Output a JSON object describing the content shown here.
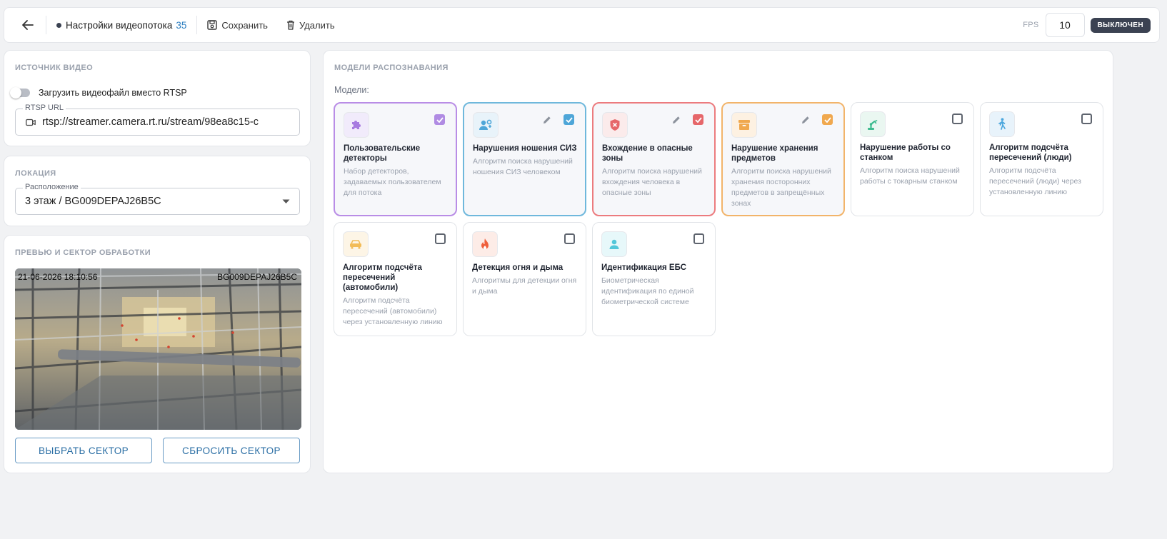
{
  "header": {
    "title": "Настройки видеопотока",
    "stream_id": "35",
    "save_label": "Сохранить",
    "delete_label": "Удалить",
    "fps_label": "FPS",
    "fps_value": "10",
    "status_label": "ВЫКЛЮЧЕН"
  },
  "source": {
    "title": "ИСТОЧНИК ВИДЕО",
    "upload_toggle_label": "Загрузить видеофайл вместо RTSP",
    "upload_toggle_on": false,
    "rtsp_label": "RTSP URL",
    "rtsp_value": "rtsp://streamer.camera.rt.ru/stream/98ea8c15-c"
  },
  "location": {
    "title": "ЛОКАЦИЯ",
    "field_label": "Расположение",
    "value": "3 этаж / BG009DEPAJ26B5C"
  },
  "preview": {
    "title": "ПРЕВЬЮ И СЕКТОР ОБРАБОТКИ",
    "timestamp": "21-06-2026 18:10:56",
    "camera_label": "BG009DEPAJ26B5C",
    "select_sector_label": "ВЫБРАТЬ СЕКТОР",
    "reset_sector_label": "СБРОСИТЬ СЕКТОР"
  },
  "models": {
    "title": "МОДЕЛИ РАСПОЗНАВАНИЯ",
    "subtitle": "Модели:",
    "cards": [
      {
        "title": "Пользовательские детекторы",
        "desc": "Набор детекторов, задаваемых пользователем для потока",
        "checked": true,
        "editable": false,
        "color": "#a77be0",
        "icon": "puzzle-icon"
      },
      {
        "title": "Нарушения ношения СИЗ",
        "desc": "Алгоритм поиска нарушений ношения СИЗ человеком",
        "checked": true,
        "editable": true,
        "color": "#5aafd9",
        "icon": "worker-gear-icon"
      },
      {
        "title": "Вхождение в опасные зоны",
        "desc": "Алгоритм поиска нарушений вхождения человека в опасные зоны",
        "checked": true,
        "editable": true,
        "color": "#e6676a",
        "icon": "shield-alert-icon"
      },
      {
        "title": "Нарушение хранения предметов",
        "desc": "Алгоритм поиска нарушений хранения посторонних предметов в запрещённых зонах",
        "checked": true,
        "editable": true,
        "color": "#f0a84e",
        "icon": "archive-box-icon"
      },
      {
        "title": "Нарушение работы со станком",
        "desc": "Алгоритм поиска нарушений работы с токарным станком",
        "checked": false,
        "editable": false,
        "color": "#3dbb8f",
        "icon": "robot-arm-icon"
      },
      {
        "title": "Алгоритм подсчёта пересечений (люди)",
        "desc": "Алгоритм подсчёта пересечений (люди) через установленную линию",
        "checked": false,
        "editable": false,
        "color": "#4aa6dd",
        "icon": "walking-person-icon"
      },
      {
        "title": "Алгоритм подсчёта пересечений (автомобили)",
        "desc": "Алгоритм подсчёта пересечений (автомобили) через установленную линию",
        "checked": false,
        "editable": false,
        "color": "#f2bc58",
        "icon": "car-icon"
      },
      {
        "title": "Детекция огня и дыма",
        "desc": "Алгоритмы для детекции огня и дыма",
        "checked": false,
        "editable": false,
        "color": "#ef5f3c",
        "icon": "fire-icon"
      },
      {
        "title": "Идентификация ЕБС",
        "desc": "Биометрическая идентификация по единой биометрической системе",
        "checked": false,
        "editable": false,
        "color": "#52c7d9",
        "icon": "person-icon"
      }
    ]
  }
}
